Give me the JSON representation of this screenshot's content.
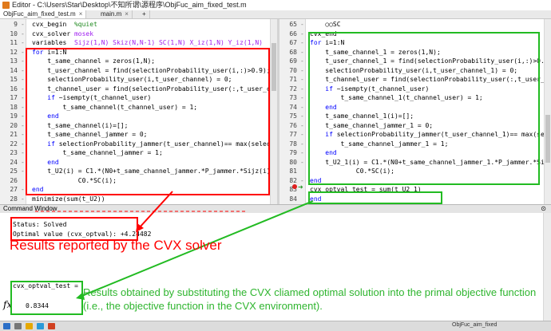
{
  "window": {
    "title": "Editor - C:\\Users\\Star\\Desktop\\不知所谓\\源程序\\ObjFuc_aim_fixed_test.m"
  },
  "tabs": [
    {
      "label": "ObjFuc_aim_fixed_test.m",
      "close": "×"
    },
    {
      "label": "main.m",
      "close": "×"
    },
    {
      "label": "+",
      "close": ""
    }
  ],
  "left_editor": {
    "lines": [
      {
        "num": "9",
        "dash": "-",
        "segments": [
          {
            "t": "cvx_begin  ",
            "c": ""
          },
          {
            "t": "%quiet",
            "c": "cm"
          }
        ]
      },
      {
        "num": "10",
        "dash": "-",
        "segments": [
          {
            "t": "cvx_solver ",
            "c": ""
          },
          {
            "t": "mosek",
            "c": "st"
          }
        ]
      },
      {
        "num": "11",
        "dash": "-",
        "segments": [
          {
            "t": "variables  ",
            "c": ""
          },
          {
            "t": "Sijz(1,N) Skiz(N,N-1) SC(1,N) X_iz(1,N) Y_iz(1,N)   W(N",
            "c": "st"
          }
        ]
      },
      {
        "num": "12",
        "dash": "-",
        "segments": [
          {
            "t": "for ",
            "c": "kw"
          },
          {
            "t": "i=1:N",
            "c": ""
          }
        ]
      },
      {
        "num": "13",
        "dash": "-",
        "segments": [
          {
            "t": "    t_same_channel = zeros(1,N);",
            "c": ""
          }
        ]
      },
      {
        "num": "14",
        "dash": "-",
        "segments": [
          {
            "t": "    t_user_channel = find(selectionProbability_user(i,:)>0.9);",
            "c": ""
          }
        ]
      },
      {
        "num": "15",
        "dash": "-",
        "segments": [
          {
            "t": "    selectionProbability_user(i,t_user_channel) = 0;",
            "c": ""
          }
        ]
      },
      {
        "num": "16",
        "dash": "-",
        "segments": [
          {
            "t": "    t_channel_user = find(selectionProbability_user(:,t_user_channel",
            "c": ""
          }
        ]
      },
      {
        "num": "17",
        "dash": "-",
        "segments": [
          {
            "t": "    ",
            "c": ""
          },
          {
            "t": "if ",
            "c": "kw"
          },
          {
            "t": "~isempty(t_channel_user)",
            "c": ""
          }
        ]
      },
      {
        "num": "18",
        "dash": "-",
        "segments": [
          {
            "t": "        t_same_channel(t_channel_user) = 1;",
            "c": ""
          }
        ]
      },
      {
        "num": "19",
        "dash": "-",
        "segments": [
          {
            "t": "    ",
            "c": ""
          },
          {
            "t": "end",
            "c": "kw"
          }
        ]
      },
      {
        "num": "20",
        "dash": "-",
        "segments": [
          {
            "t": "    t_same_channel(i)=[];",
            "c": ""
          }
        ]
      },
      {
        "num": "21",
        "dash": "-",
        "segments": [
          {
            "t": "    t_same_channel_jammer = 0;",
            "c": ""
          }
        ]
      },
      {
        "num": "22",
        "dash": "-",
        "segments": [
          {
            "t": "    ",
            "c": ""
          },
          {
            "t": "if ",
            "c": "kw"
          },
          {
            "t": "selectionProbability_jammer(t_user_channel)== max(selectionPr",
            "c": ""
          }
        ]
      },
      {
        "num": "23",
        "dash": "-",
        "segments": [
          {
            "t": "        t_same_channel_jammer = 1;",
            "c": ""
          }
        ]
      },
      {
        "num": "24",
        "dash": "-",
        "segments": [
          {
            "t": "    ",
            "c": ""
          },
          {
            "t": "end",
            "c": "kw"
          }
        ]
      },
      {
        "num": "25",
        "dash": "-",
        "segments": [
          {
            "t": "    t_U2(i) = C1.*(N0+t_same_channel_jammer.*P_jammer.*Sijz(i)+sum(t",
            "c": ""
          }
        ]
      },
      {
        "num": "26",
        "dash": "",
        "segments": [
          {
            "t": "            C0.*SC(i);",
            "c": ""
          }
        ]
      },
      {
        "num": "27",
        "dash": "-",
        "segments": [
          {
            "t": "end",
            "c": "kw"
          }
        ]
      },
      {
        "num": "28",
        "dash": "-",
        "segments": [
          {
            "t": "minimize(sum(t_U2))",
            "c": ""
          }
        ]
      }
    ]
  },
  "right_editor": {
    "lines": [
      {
        "num": "65",
        "dash": "-",
        "segments": [
          {
            "t": "    ○○SC",
            "c": ""
          }
        ]
      },
      {
        "num": "66",
        "dash": "-",
        "segments": [
          {
            "t": "cvx_end",
            "c": ""
          }
        ]
      },
      {
        "num": "67",
        "dash": "-",
        "segments": [
          {
            "t": "for ",
            "c": "kw"
          },
          {
            "t": "i=1:N",
            "c": ""
          }
        ]
      },
      {
        "num": "68",
        "dash": "-",
        "segments": [
          {
            "t": "    t_same_channel_1 = zeros(1,N);",
            "c": ""
          }
        ]
      },
      {
        "num": "69",
        "dash": "-",
        "segments": [
          {
            "t": "    t_user_channel_1 = find(selectionProbability_user(i,:)>0.9);",
            "c": ""
          }
        ]
      },
      {
        "num": "70",
        "dash": "-",
        "segments": [
          {
            "t": "    selectionProbability_user(i,t_user_channel_1) = 0;",
            "c": ""
          }
        ]
      },
      {
        "num": "71",
        "dash": "-",
        "segments": [
          {
            "t": "    t_channel_user = find(selectionProbability_user(:,t_user_channel",
            "c": ""
          }
        ]
      },
      {
        "num": "72",
        "dash": "-",
        "segments": [
          {
            "t": "    ",
            "c": ""
          },
          {
            "t": "if ",
            "c": "kw"
          },
          {
            "t": "~isempty(t_channel_user)",
            "c": ""
          }
        ]
      },
      {
        "num": "73",
        "dash": "-",
        "segments": [
          {
            "t": "        t_same_channel_1(t_channel_user) = 1;",
            "c": ""
          }
        ]
      },
      {
        "num": "74",
        "dash": "-",
        "segments": [
          {
            "t": "    ",
            "c": ""
          },
          {
            "t": "end",
            "c": "kw"
          }
        ]
      },
      {
        "num": "75",
        "dash": "-",
        "segments": [
          {
            "t": "    t_same_channel_1(i)=[];",
            "c": ""
          }
        ]
      },
      {
        "num": "76",
        "dash": "-",
        "segments": [
          {
            "t": "    t_same_channel_jammer_1 = 0;",
            "c": ""
          }
        ]
      },
      {
        "num": "77",
        "dash": "-",
        "segments": [
          {
            "t": "    ",
            "c": ""
          },
          {
            "t": "if ",
            "c": "kw"
          },
          {
            "t": "selectionProbability_jammer(t_user_channel_1)== max(selectior",
            "c": ""
          }
        ]
      },
      {
        "num": "78",
        "dash": "-",
        "segments": [
          {
            "t": "        t_same_channel_jammer_1 = 1;",
            "c": ""
          }
        ]
      },
      {
        "num": "79",
        "dash": "-",
        "segments": [
          {
            "t": "    ",
            "c": ""
          },
          {
            "t": "end",
            "c": "kw"
          }
        ]
      },
      {
        "num": "80",
        "dash": "-",
        "segments": [
          {
            "t": "    t_U2_1(i) = C1.*(N0+t_same_channel_jammer_1.*P_jammer.*Sijz(i)+s",
            "c": ""
          }
        ]
      },
      {
        "num": "81",
        "dash": "",
        "segments": [
          {
            "t": "            C0.*SC(i);",
            "c": ""
          }
        ]
      },
      {
        "num": "82",
        "dash": "-",
        "segments": [
          {
            "t": "end",
            "c": "kw"
          }
        ]
      },
      {
        "num": "83",
        "dash": "",
        "segments": [
          {
            "t": "cvx_optval_test = sum(t_U2_1)",
            "c": ""
          }
        ]
      },
      {
        "num": "84",
        "dash": "",
        "segments": [
          {
            "t": "end",
            "c": "kw"
          }
        ]
      }
    ]
  },
  "command_window": {
    "title": "Command Window",
    "status_line": "Status: Solved",
    "optval_line": "Optimal value (cvx_optval): +4.24482",
    "test_label": "cvx_optval_test =",
    "test_value": "0.8344",
    "prompt": "fx"
  },
  "statusbar": {
    "text": "ObjFuc_aim_fixed"
  },
  "annotations": {
    "red_caption": "Results reported by the CVX solver",
    "green_caption": "Results obtained by substituting the CVX cliamed optimal solution into the primal objective function (i.e., the objective function in the CVX environment).",
    "red_color": "#ff0000",
    "green_color": "#22bb22"
  }
}
